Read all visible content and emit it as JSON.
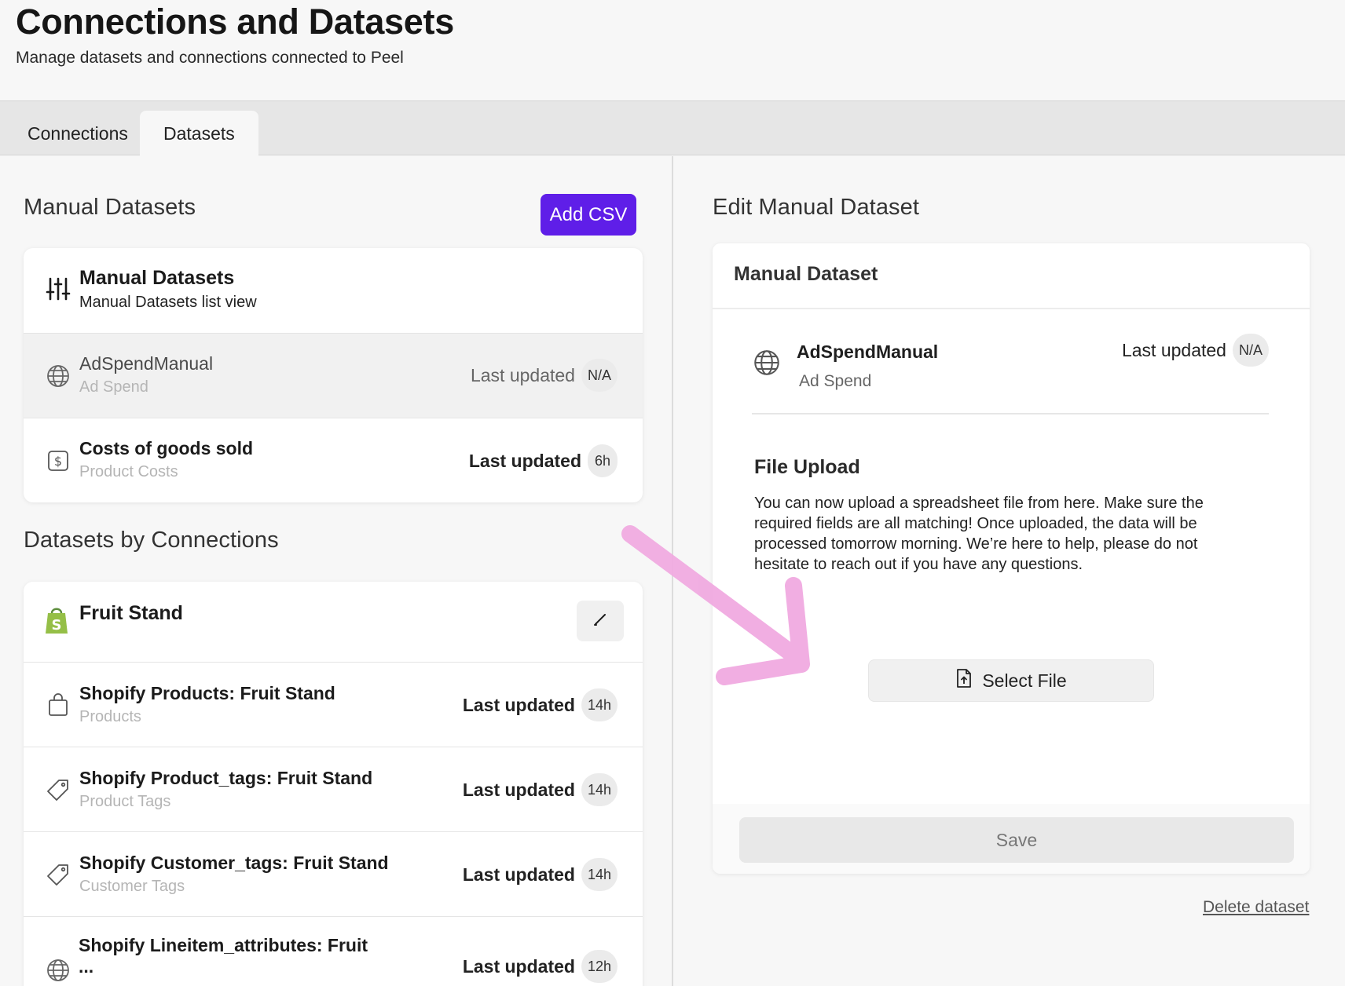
{
  "header": {
    "title": "Connections and Datasets",
    "subtitle": "Manage datasets and connections connected to Peel"
  },
  "tabs": [
    {
      "label": "Connections",
      "active": false
    },
    {
      "label": "Datasets",
      "active": true
    }
  ],
  "manual": {
    "section_title": "Manual Datasets",
    "add_csv_label": "Add CSV",
    "card_header": {
      "title": "Manual Datasets",
      "subtitle": "Manual Datasets list view",
      "icon": "sliders-icon"
    },
    "rows": [
      {
        "title": "AdSpendManual",
        "subtitle": "Ad Spend",
        "last_updated_label": "Last updated",
        "badge": "N/A",
        "icon": "globe-icon",
        "selected": true
      },
      {
        "title": "Costs of goods sold",
        "subtitle": "Product Costs",
        "last_updated_label": "Last updated",
        "badge": "6h",
        "icon": "dollar-icon",
        "selected": false
      }
    ]
  },
  "connections": {
    "section_title": "Datasets by Connections",
    "group": {
      "title": "Fruit Stand",
      "icon": "shopify-icon"
    },
    "rows": [
      {
        "title": "Shopify Products: Fruit Stand",
        "subtitle": "Products",
        "last_updated_label": "Last updated",
        "badge": "14h",
        "icon": "bag-icon"
      },
      {
        "title": "Shopify Product_tags: Fruit Stand",
        "subtitle": "Product Tags",
        "last_updated_label": "Last updated",
        "badge": "14h",
        "icon": "tag-icon"
      },
      {
        "title": "Shopify Customer_tags: Fruit Stand",
        "subtitle": "Customer Tags",
        "last_updated_label": "Last updated",
        "badge": "14h",
        "icon": "tag-icon"
      },
      {
        "title": "Shopify Lineitem_attributes: Fruit",
        "subtitle": "...",
        "last_updated_label": "Last updated",
        "badge": "12h",
        "icon": "globe-icon"
      }
    ]
  },
  "edit": {
    "section_title": "Edit Manual Dataset",
    "card_title": "Manual Dataset",
    "dataset_name": "AdSpendManual",
    "dataset_type": "Ad Spend",
    "last_updated_label": "Last updated",
    "badge": "N/A",
    "file_upload_title": "File Upload",
    "file_upload_text": "You can now upload a spreadsheet file from here. Make sure the required fields are all matching! Once uploaded, the data will be processed tomorrow morning. We’re here to help, please do not hesitate to reach out if you have any questions.",
    "select_file_label": "Select File",
    "save_label": "Save",
    "delete_label": "Delete dataset"
  },
  "colors": {
    "accent": "#5f1ee8",
    "annotation_arrow": "#f0a8e0",
    "shopify_green": "#95bf47"
  }
}
